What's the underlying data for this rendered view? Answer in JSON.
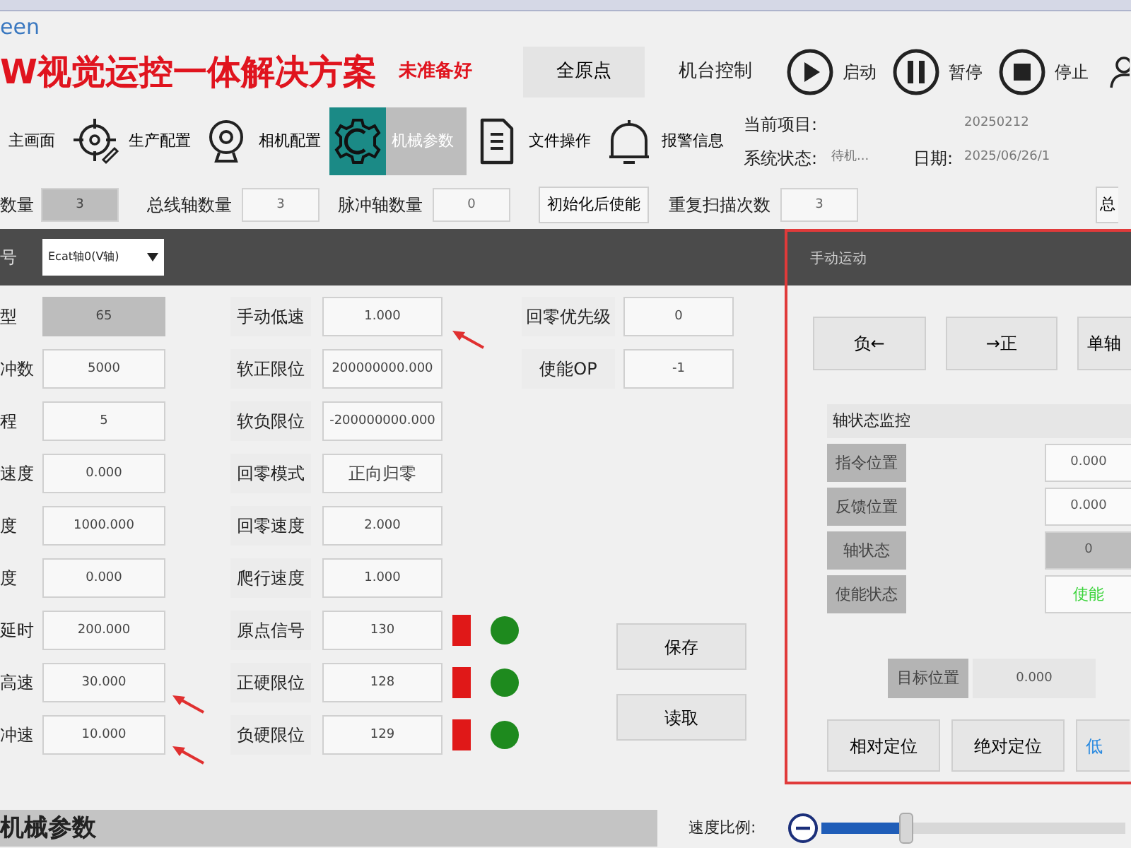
{
  "brand_fragment": "een",
  "header": {
    "title": "W视觉运控一体解决方案",
    "status": "未准备好",
    "home_button": "全原点",
    "machine_control": "机台控制",
    "controls": [
      {
        "kind": "play",
        "label": "启动"
      },
      {
        "kind": "pause",
        "label": "暂停"
      },
      {
        "kind": "stop",
        "label": "停止"
      }
    ]
  },
  "nav": [
    {
      "kind": "plain",
      "label": "主画面",
      "selected": false
    },
    {
      "kind": "target",
      "label": "生产配置",
      "selected": false
    },
    {
      "kind": "camera",
      "label": "相机配置",
      "selected": false
    },
    {
      "kind": "gear",
      "label": "机械参数",
      "selected": true
    },
    {
      "kind": "document",
      "label": "文件操作",
      "selected": false
    },
    {
      "kind": "bell",
      "label": "报警信息",
      "selected": false
    }
  ],
  "info": {
    "project_label": "当前项目:",
    "project": "20250212",
    "state_label": "系统状态:",
    "state": "待机...",
    "date_label": "日期:",
    "date": "2025/06/26/1"
  },
  "toolbar": [
    {
      "kind": "field",
      "label": "数量",
      "value": "3",
      "disabled": true
    },
    {
      "kind": "field",
      "label": "总线轴数量",
      "value": "3",
      "disabled": false
    },
    {
      "kind": "field",
      "label": "脉冲轴数量",
      "value": "0",
      "disabled": false
    },
    {
      "kind": "button",
      "label": "初始化后使能"
    },
    {
      "kind": "field",
      "label": "重复扫描次数",
      "value": "3",
      "disabled": false
    },
    {
      "kind": "edge",
      "label": "总"
    }
  ],
  "axis_bar": {
    "label": "号",
    "select": "Ecat轴0(V轴)"
  },
  "params_col1": [
    {
      "label": "型",
      "value": "65",
      "disabled": true
    },
    {
      "label": "冲数",
      "value": "5000",
      "disabled": false
    },
    {
      "label": "程",
      "value": "5",
      "disabled": false
    },
    {
      "label": "速度",
      "value": "0.000",
      "disabled": false
    },
    {
      "label": "度",
      "value": "1000.000",
      "disabled": false
    },
    {
      "label": "度",
      "value": "0.000",
      "disabled": false
    },
    {
      "label": "延时",
      "value": "200.000",
      "disabled": false
    },
    {
      "label": "高速",
      "value": "30.000",
      "disabled": false
    },
    {
      "label": "冲速",
      "value": "10.000",
      "disabled": false
    }
  ],
  "params_col2": [
    {
      "label": "手动低速",
      "value": "1.000"
    },
    {
      "label": "软正限位",
      "value": "200000000.000"
    },
    {
      "label": "软负限位",
      "value": "-200000000.000"
    },
    {
      "label": "回零模式",
      "value": "正向归零"
    },
    {
      "label": "回零速度",
      "value": "2.000"
    },
    {
      "label": "爬行速度",
      "value": "1.000"
    },
    {
      "label": "原点信号",
      "value": "130",
      "indicators": [
        {
          "kind": "square",
          "color": "#e01818"
        },
        {
          "kind": "dot",
          "color": "#1e8a1e"
        }
      ]
    },
    {
      "label": "正硬限位",
      "value": "128",
      "indicators": [
        {
          "kind": "square",
          "color": "#e01818"
        },
        {
          "kind": "dot",
          "color": "#1e8a1e"
        }
      ]
    },
    {
      "label": "负硬限位",
      "value": "129",
      "indicators": [
        {
          "kind": "square",
          "color": "#e01818"
        },
        {
          "kind": "dot",
          "color": "#1e8a1e"
        }
      ]
    }
  ],
  "params_col3": [
    {
      "label": "回零优先级",
      "value": "0"
    },
    {
      "label": "使能OP",
      "value": "-1"
    }
  ],
  "side_buttons": [
    "保存",
    "读取"
  ],
  "manual_panel": {
    "title": "手动运动",
    "jog_buttons": [
      "负←",
      "→正",
      "单轴"
    ],
    "monitor": {
      "title": "轴状态监控",
      "rows": [
        {
          "label": "指令位置",
          "value": "0.000",
          "kind": "plain"
        },
        {
          "label": "反馈位置",
          "value": "0.000",
          "kind": "plain"
        },
        {
          "label": "轴状态",
          "value": "0",
          "kind": "shaded"
        },
        {
          "label": "使能状态",
          "value": "使能",
          "kind": "enabled"
        }
      ]
    },
    "target": {
      "label": "目标位置",
      "value": "0.000"
    },
    "move_buttons": [
      {
        "label": "相对定位",
        "kind": "normal"
      },
      {
        "label": "绝对定位",
        "kind": "normal"
      },
      {
        "label": "低",
        "kind": "accent"
      }
    ]
  },
  "footer": {
    "section_title": "机械参数",
    "speed_label": "速度比例:",
    "speed": {
      "level": 0.28
    }
  }
}
